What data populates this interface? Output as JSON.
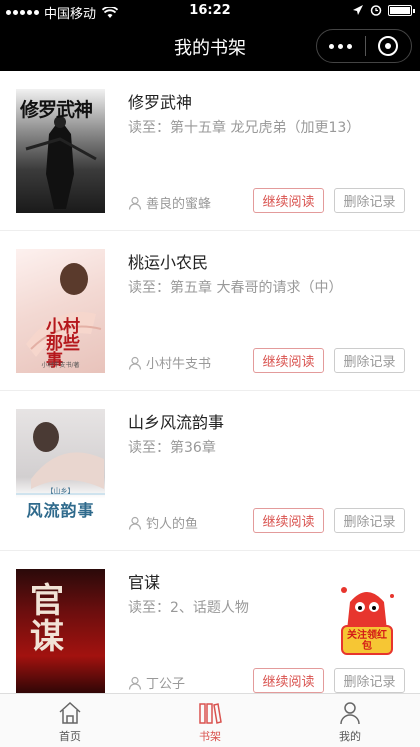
{
  "status_bar": {
    "carrier": "中国移动",
    "time": "16:22"
  },
  "nav": {
    "title": "我的书架"
  },
  "books": [
    {
      "title": "修罗武神",
      "progress": "读至：第十五章 龙兄虎弟（加更13）",
      "author": "善良的蜜蜂",
      "cover_text": "修罗武神"
    },
    {
      "title": "桃运小农民",
      "progress": "读至：第五章 大春哥的请求（中）",
      "author": "小村牛支书",
      "cover_text": "小村那些事",
      "cover_footer": "小村牛支书/著"
    },
    {
      "title": "山乡风流韵事",
      "progress": "读至：第36章",
      "author": "钓人的鱼",
      "cover_text": "风流韵事",
      "cover_tag": "【山乡】"
    },
    {
      "title": "官谋",
      "progress": "读至：2、话题人物",
      "author": "丁公子",
      "cover_text": "官谋"
    }
  ],
  "buttons": {
    "continue": "继续阅读",
    "delete": "删除记录"
  },
  "float_ad": {
    "text": "关注领红包"
  },
  "tabs": [
    {
      "label": "首页",
      "icon": "home-icon",
      "active": false
    },
    {
      "label": "书架",
      "icon": "bookshelf-icon",
      "active": true
    },
    {
      "label": "我的",
      "icon": "profile-icon",
      "active": false
    }
  ],
  "colors": {
    "accent": "#d9534f",
    "nav_bg": "#000000"
  }
}
